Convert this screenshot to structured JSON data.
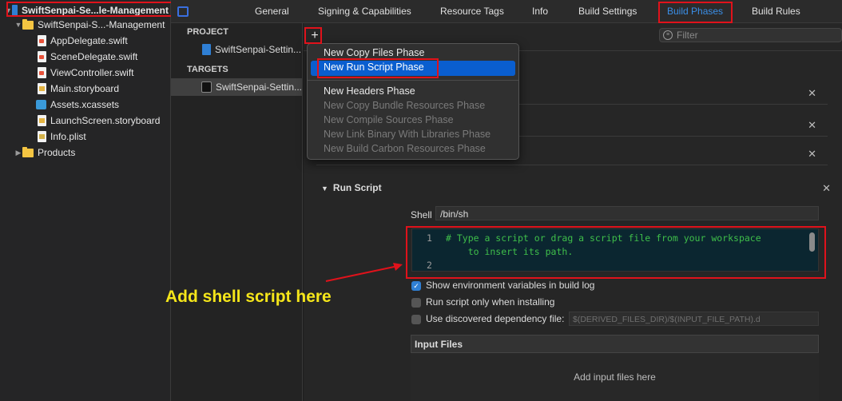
{
  "navigator": {
    "project_name": "SwiftSenpai-Se...le-Management",
    "group_name": "SwiftSenpai-S...-Management",
    "files": [
      "AppDelegate.swift",
      "SceneDelegate.swift",
      "ViewController.swift",
      "Main.storyboard",
      "Assets.xcassets",
      "LaunchScreen.storyboard",
      "Info.plist"
    ],
    "products": "Products"
  },
  "tabs": [
    "General",
    "Signing & Capabilities",
    "Resource Tags",
    "Info",
    "Build Settings",
    "Build Phases",
    "Build Rules"
  ],
  "active_tab": "Build Phases",
  "targets_panel": {
    "project_header": "PROJECT",
    "project_item": "SwiftSenpai-Settin...",
    "targets_header": "TARGETS",
    "target_item": "SwiftSenpai-Settin..."
  },
  "toolbar": {
    "add_symbol": "+",
    "filter_placeholder": "Filter"
  },
  "add_menu": {
    "items": [
      "New Copy Files Phase",
      "New Run Script Phase",
      "New Headers Phase",
      "New Copy Bundle Resources Phase",
      "New Compile Sources Phase",
      "New Link Binary With Libraries Phase",
      "New Build Carbon Resources Phase"
    ],
    "selected": "New Run Script Phase"
  },
  "run_script": {
    "title": "Run Script",
    "shell_label": "Shell",
    "shell_value": "/bin/sh",
    "line1": "1",
    "line2": "2",
    "code_line1": "# Type a script or drag a script file from your workspace",
    "code_line2": "    to insert its path.",
    "opt_show_env": "Show environment variables in build log",
    "opt_only_install": "Run script only when installing",
    "opt_dep_file": "Use discovered dependency file:",
    "dep_file_placeholder": "$(DERIVED_FILES_DIR)/$(INPUT_FILE_PATH).d",
    "input_files_header": "Input Files",
    "add_input_files": "Add input files here"
  },
  "annotation": {
    "text": "Add shell script here",
    "color": "#f5e61a"
  },
  "colors": {
    "accent": "#3a8ee6",
    "highlight": "#0a5ecf",
    "annotation_red": "#e0121b",
    "code_green": "#3fbf4a"
  }
}
